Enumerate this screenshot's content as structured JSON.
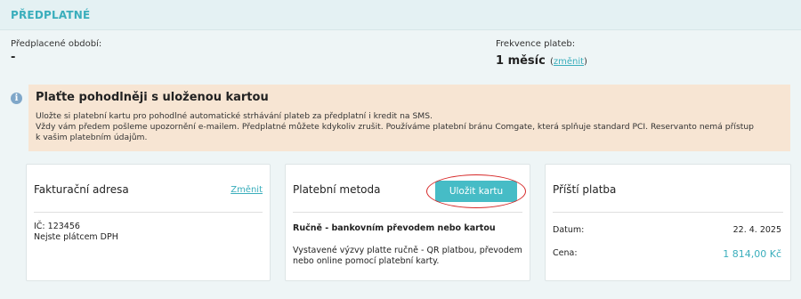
{
  "header": {
    "title": "PŘEDPLATNÉ"
  },
  "subscription": {
    "prepaid_label": "Předplacené období:",
    "prepaid_value": "-",
    "frequency_label": "Frekvence plateb:",
    "frequency_value": "1 měsíc",
    "change_link_open": "(",
    "change_link": "změnit",
    "change_link_close": ")"
  },
  "notice": {
    "icon": "info-icon",
    "title": "Plaťte pohodlněji s uloženou kartou",
    "lines": [
      "Uložte si platební kartu pro pohodlné automatické strhávání plateb za předplatní i kredit na SMS.",
      "Vždy vám předem pošleme upozornění e-mailem. Předplatné můžete kdykoliv zrušit. Používáme platební bránu Comgate, která splňuje standard PCI. Reservanto nemá přístup",
      "k vašim platebním údajům."
    ]
  },
  "billing": {
    "title": "Fakturační adresa",
    "change_link": "Změnit",
    "ic_line": "IČ: 123456",
    "vat_line": "Nejste plátcem DPH"
  },
  "payment_method": {
    "title": "Platební metoda",
    "save_card_label": "Uložit kartu",
    "method_name": "Ručně - bankovním převodem nebo kartou",
    "description_line1": "Vystavené výzvy platte ručně - QR platbou, převodem",
    "description_line2": "nebo online pomocí platební karty."
  },
  "next_payment": {
    "title": "Příští platba",
    "date_label": "Datum:",
    "date_value": "22. 4. 2025",
    "price_label": "Cena:",
    "price_value": "1 814,00 Kč"
  },
  "colors": {
    "accent": "#3aaebc",
    "button": "#46bcc6",
    "notice_bg": "#f7e5d3",
    "highlight": "#d62828"
  }
}
